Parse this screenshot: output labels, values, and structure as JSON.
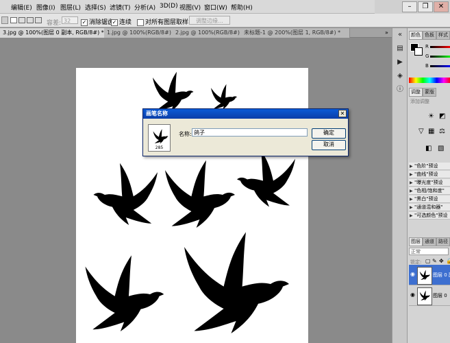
{
  "menu": {
    "items": [
      "编辑(E)",
      "图像(I)",
      "图层(L)",
      "选择(S)",
      "滤镜(T)",
      "分析(A)",
      "3D(D)",
      "视图(V)",
      "窗口(W)",
      "帮助(H)"
    ]
  },
  "window": {
    "minimize": "–",
    "restore": "❐",
    "close": "✕"
  },
  "options": {
    "tolerance_label": "容差:",
    "tolerance_value": "32",
    "antialias_label": "消除锯齿",
    "contiguous_label": "连续",
    "sample_all_label": "对所有图层取样",
    "refine_edge_label": "调整边缘..."
  },
  "tabs": [
    "3.jpg @ 100%(图层 0 副本, RGB/8#) *",
    "1.jpg @ 100%(RGB/8#)",
    "2.jpg @ 100%(RGB/8#)",
    "未标题-1 @ 200%(图层 1, RGB/8#) *"
  ],
  "panels": {
    "color_tab": "颜色",
    "swatches_tab": "色板",
    "styles_tab": "样式",
    "adjust_tab": "调整",
    "masks_tab": "蒙版",
    "add_adjustment": "添加调整",
    "presets": [
      "\"色阶\"预设",
      "\"曲线\"预设",
      "\"曝光度\"预设",
      "\"色相/饱和度\"",
      "\"黑白\"预设",
      "\"通道混和器\"",
      "\"可选颜色\"预设"
    ],
    "layers_tab": "图层",
    "channels_tab": "通道",
    "paths_tab": "路径",
    "blend_mode": "正常",
    "lock_label": "锁定:",
    "layers": [
      "图层 0 副本",
      "图层 0"
    ],
    "color_letters": [
      "R",
      "G",
      "B"
    ]
  },
  "dialog": {
    "title": "画笔名称",
    "close": "✕",
    "brush_size": "285",
    "name_label": "名称:",
    "name_value": "鸽子",
    "ok_label": "确定",
    "cancel_label": "取消"
  },
  "colors": {
    "dialog_title_bar": "#0a4cc2",
    "ui_gray": "#d4d4d4",
    "canvas_bg": "#8a8a8a"
  }
}
